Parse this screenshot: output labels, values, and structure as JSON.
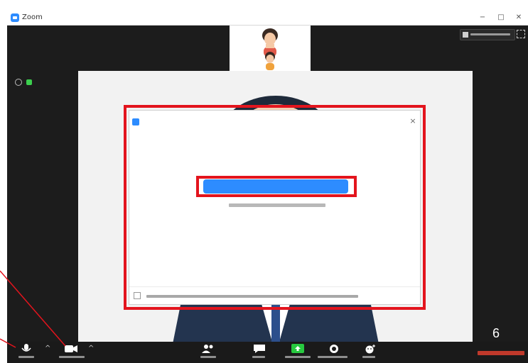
{
  "window": {
    "title": "Zoom",
    "minimize_glyph": "−",
    "maximize_glyph": "□",
    "close_glyph": "✕"
  },
  "audio_dialog": {
    "close_glyph": "×"
  },
  "page_number": "6",
  "colors": {
    "accent_blue": "#2d8cff",
    "highlight_red": "#e3141d",
    "meeting_background": "#1c1c1c"
  }
}
